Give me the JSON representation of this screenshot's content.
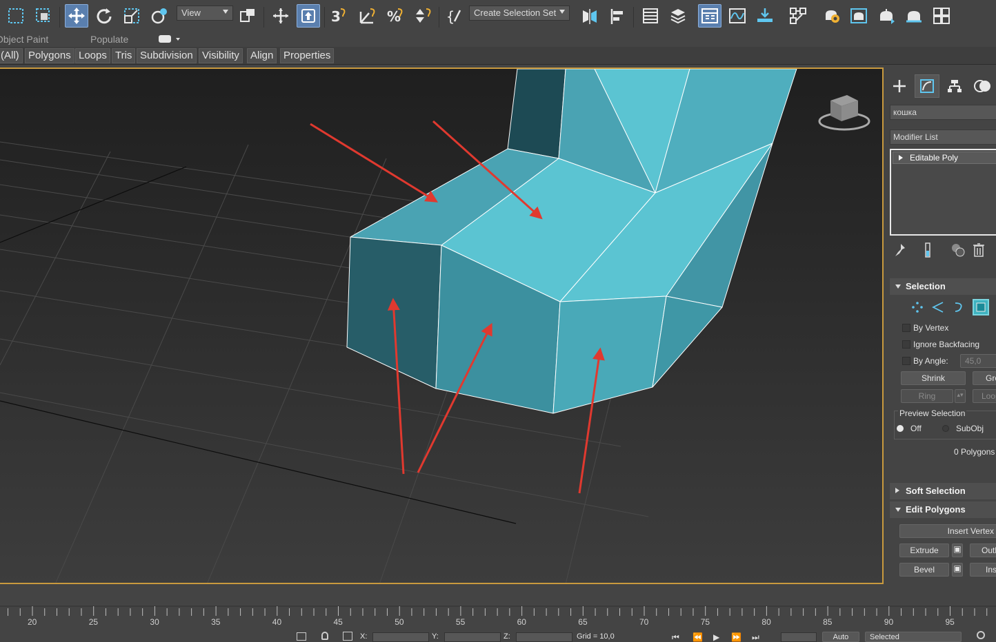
{
  "toolbar": {
    "view_label": "View",
    "create_selection_set_label": "Create Selection Set"
  },
  "ribbon": {
    "row1": {
      "object_paint": "Object Paint",
      "populate": "Populate"
    },
    "tabs": [
      "(All)",
      "Polygons",
      "Loops",
      "Tris",
      "Subdivision",
      "Visibility",
      "Align",
      "Properties"
    ]
  },
  "viewport": {
    "model_color": "#5bc4d2",
    "annotation_color": "#e0392f",
    "border_color": "#c99a3e"
  },
  "panel": {
    "object_name": "кошка",
    "modifier_list": "Modifier List",
    "stack_item": "Editable Poly",
    "selection": {
      "title": "Selection",
      "by_vertex": "By Vertex",
      "ignore_backfacing": "Ignore Backfacing",
      "by_angle": "By Angle:",
      "angle_value": "45,0",
      "shrink": "Shrink",
      "grow": "Grow",
      "ring": "Ring",
      "loop": "Loop",
      "preview_selection": "Preview Selection",
      "off": "Off",
      "subobj": "SubObj",
      "count": "0 Polygons"
    },
    "soft_selection": "Soft Selection",
    "edit_polygons": {
      "title": "Edit Polygons",
      "insert_vertex": "Insert Vertex",
      "extrude": "Extrude",
      "outline": "Outline",
      "bevel": "Bevel",
      "inset": "Inset"
    }
  },
  "timeline": {
    "ticks": [
      "20",
      "25",
      "30",
      "35",
      "40",
      "45",
      "50",
      "55",
      "60",
      "65",
      "70",
      "75",
      "80",
      "85",
      "90",
      "95"
    ]
  },
  "status": {
    "x_label": "X:",
    "y_label": "Y:",
    "z_label": "Z:",
    "grid": "Grid = 10,0",
    "auto": "Auto",
    "selected": "Selected"
  }
}
